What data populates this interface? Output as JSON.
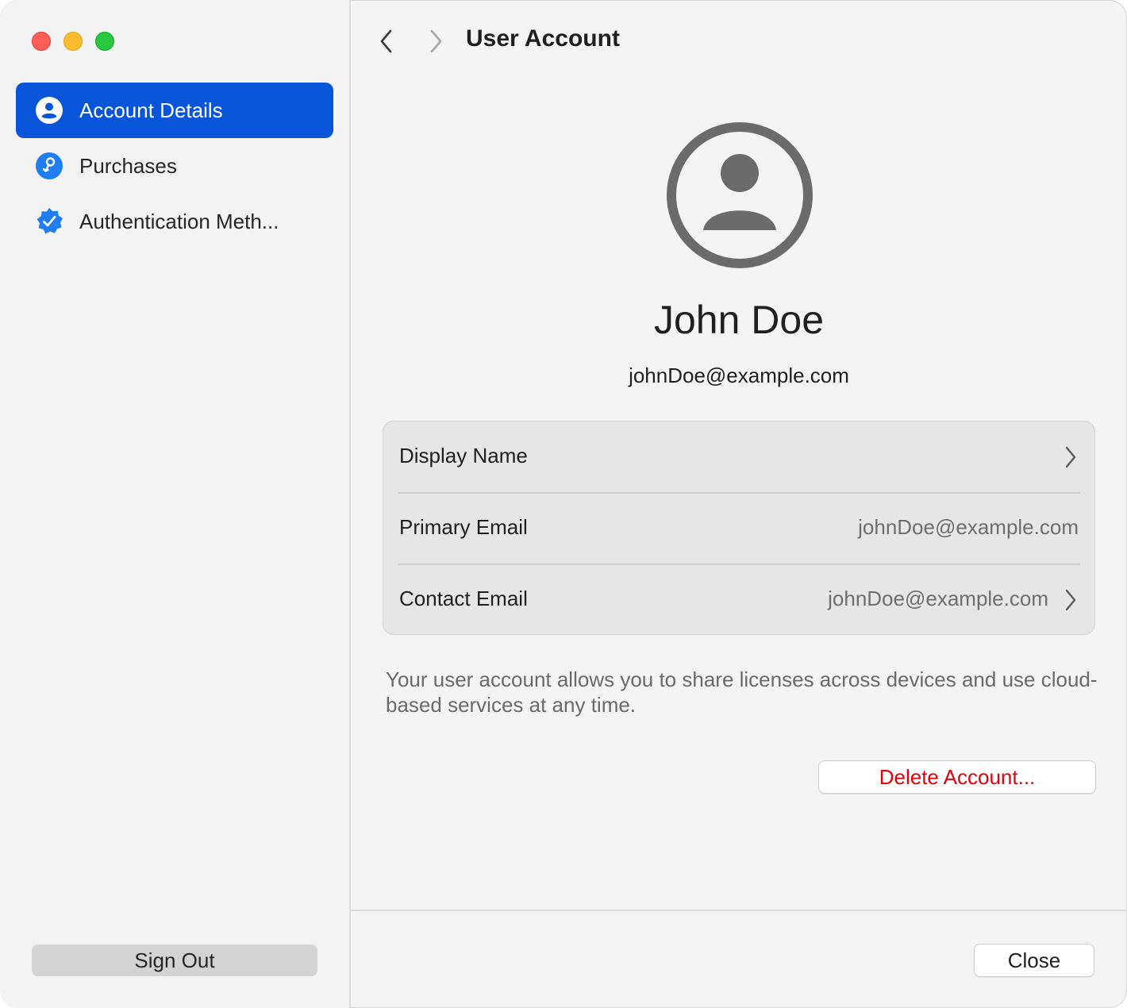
{
  "window": {
    "traffic_lights": [
      "close",
      "minimize",
      "zoom"
    ]
  },
  "sidebar": {
    "items": [
      {
        "label": "Account Details",
        "icon": "person-circle-icon",
        "selected": true
      },
      {
        "label": "Purchases",
        "icon": "purchases-icon",
        "selected": false
      },
      {
        "label": "Authentication Meth...",
        "icon": "verified-checkmark-icon",
        "selected": false
      }
    ],
    "sign_out_label": "Sign Out"
  },
  "header": {
    "title": "User Account",
    "back_icon": "chevron-left-icon",
    "forward_icon": "chevron-right-icon"
  },
  "profile": {
    "avatar_icon": "person-circle-icon",
    "name": "John Doe",
    "email": "johnDoe@example.com"
  },
  "details": {
    "rows": [
      {
        "label": "Display Name",
        "value": "",
        "has_chevron": true
      },
      {
        "label": "Primary Email",
        "value": "johnDoe@example.com",
        "has_chevron": false
      },
      {
        "label": "Contact Email",
        "value": "johnDoe@example.com",
        "has_chevron": true
      }
    ]
  },
  "description": "Your user account allows you to share licenses across devices and use cloud-based services at any time.",
  "buttons": {
    "delete_label": "Delete Account...",
    "close_label": "Close"
  },
  "colors": {
    "accent": "#0855d9",
    "destructive": "#e7000b",
    "sidebar_icon_blue": "#1e7ef2"
  }
}
